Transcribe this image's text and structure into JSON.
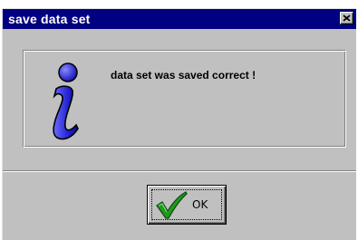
{
  "window": {
    "title": "save data set",
    "close_icon": "close-icon"
  },
  "message": {
    "icon": "info-icon",
    "text": "data set was saved correct !"
  },
  "buttons": {
    "ok": {
      "label": "OK",
      "icon": "checkmark-icon"
    }
  },
  "colors": {
    "titlebar": "#000080",
    "dialog_face": "#c0c0c0",
    "info_icon": "#2a2ad8",
    "checkmark": "#1a8a1a"
  }
}
